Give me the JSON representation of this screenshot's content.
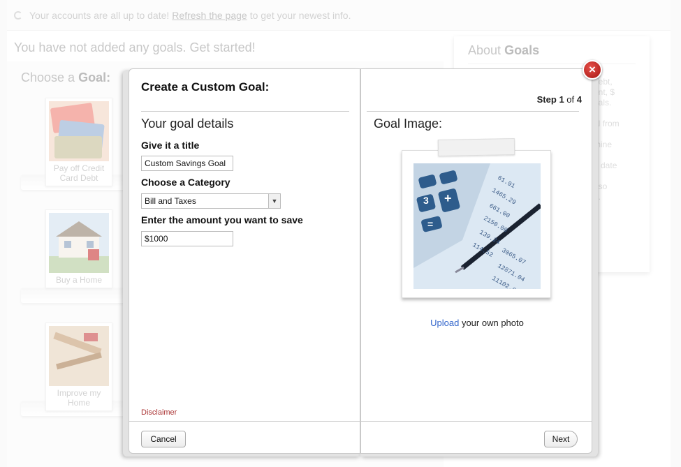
{
  "status": {
    "before": "Your accounts are all up to date!",
    "link": "Refresh the page",
    "after": "to get your newest info."
  },
  "empty_state": "You have not added any goals. Get started!",
  "choose_goal": {
    "prefix": "Choose a",
    "bold": "Goal:"
  },
  "goals": [
    {
      "line1": "Pay off Credit",
      "line2": "Card Debt"
    },
    {
      "line1": "Buy a Home",
      "line2": ""
    },
    {
      "line1": "Improve my",
      "line2": "Home"
    }
  ],
  "about": {
    "prefix": "About",
    "bold": "Goals",
    "lines": [
      "debt,",
      "ent, $",
      "oals.",
      "",
      "al from",
      "",
      "mine",
      "",
      "d date",
      "",
      "t so",
      "n."
    ]
  },
  "modal": {
    "title": "Create a Custom Goal:",
    "section_left": "Your goal details",
    "title_label": "Give it a title",
    "title_value": "Custom Savings Goal",
    "category_label": "Choose a Category",
    "category_value": "Bill and Taxes",
    "amount_label": "Enter the amount you want to save",
    "amount_value": "$1000",
    "disclaimer": "Disclaimer",
    "cancel": "Cancel",
    "step_prefix": "Step",
    "step_current": "1",
    "step_of": "of",
    "step_total": "4",
    "section_right": "Goal Image:",
    "upload_link": "Upload",
    "upload_rest": "your own photo",
    "next": "Next",
    "close": "×"
  }
}
